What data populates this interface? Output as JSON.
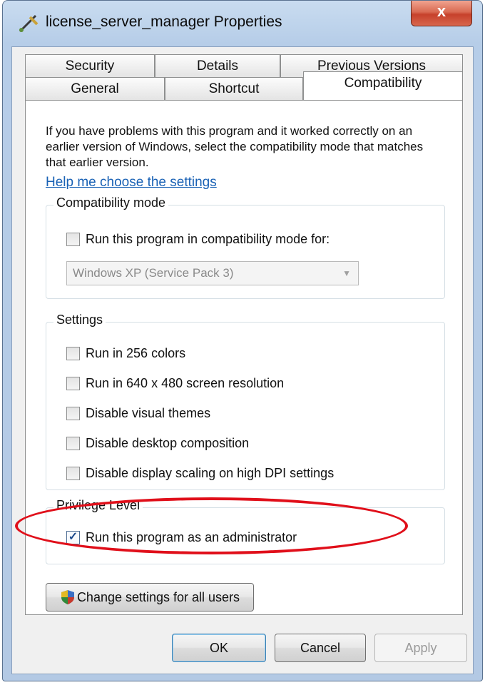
{
  "window": {
    "title": "license_server_manager Properties",
    "close_label": "x"
  },
  "tabs": {
    "row1": [
      "Security",
      "Details",
      "Previous Versions"
    ],
    "row2": [
      "General",
      "Shortcut",
      "Compatibility"
    ],
    "active": "Compatibility"
  },
  "compatibility": {
    "intro": "If you have problems with this program and it worked correctly on an earlier version of Windows, select the compatibility mode that matches that earlier version.",
    "help_link": "Help me choose the settings",
    "mode_group": {
      "legend": "Compatibility mode",
      "checkbox_label": "Run this program in compatibility mode for:",
      "checked": false,
      "selected_os": "Windows XP (Service Pack 3)"
    },
    "settings_group": {
      "legend": "Settings",
      "items": [
        {
          "label": "Run in 256 colors",
          "checked": false
        },
        {
          "label": "Run in 640 x 480 screen resolution",
          "checked": false
        },
        {
          "label": "Disable visual themes",
          "checked": false
        },
        {
          "label": "Disable desktop composition",
          "checked": false
        },
        {
          "label": "Disable display scaling on high DPI settings",
          "checked": false
        }
      ]
    },
    "privilege_group": {
      "legend": "Privilege Level",
      "checkbox_label": "Run this program as an administrator",
      "checked": true
    },
    "change_all_users_label": "Change settings for all users"
  },
  "buttons": {
    "ok": "OK",
    "cancel": "Cancel",
    "apply": "Apply"
  },
  "colors": {
    "highlight": "#e00f1a",
    "link": "#1a62b5"
  }
}
